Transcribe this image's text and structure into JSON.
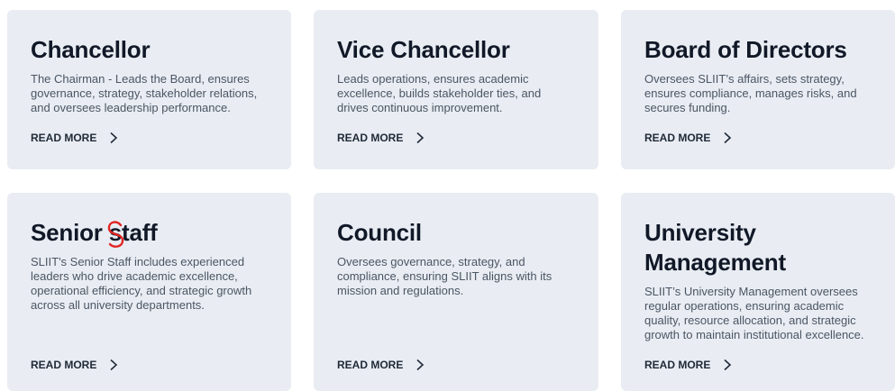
{
  "cards": [
    {
      "title": "Chancellor",
      "description": "The Chairman - Leads the Board, ensures governance, strategy, stakeholder relations, and oversees leadership performance.",
      "link_label": "READ MORE"
    },
    {
      "title": "Vice Chancellor",
      "description": "Leads operations, ensures academic excellence, builds stakeholder ties, and drives continuous improvement.",
      "link_label": "READ MORE"
    },
    {
      "title": "Board of Directors",
      "description": "Oversees SLIIT’s affairs, sets strategy, ensures compliance, manages risks, and secures funding.",
      "link_label": "READ MORE"
    },
    {
      "title_part1": "Senior ",
      "title_mark_letter": "s",
      "title_part2": "taff",
      "description": "SLIIT's Senior Staff includes experienced leaders who drive academic excellence, operational efficiency, and strategic growth across all university departments.",
      "link_label": "READ MORE"
    },
    {
      "title": "Council",
      "description": "Oversees governance, strategy, and compliance, ensuring SLIIT aligns with its mission and regulations.",
      "link_label": "READ MORE"
    },
    {
      "title_line1": "University",
      "title_line2": "Management",
      "description": "SLIIT’s University Management oversees regular operations, ensuring academic quality, resource allocation, and strategic growth to maintain institutional excellence.",
      "link_label": "READ MORE"
    }
  ],
  "colors": {
    "card_bg": "#e9edf3",
    "title": "#111827",
    "text": "#4b5563",
    "link": "#1f2937",
    "annotation": "#e02424"
  },
  "icons": {
    "read_more": "chevron-right-icon",
    "annotation": "red-circle-annotation"
  }
}
